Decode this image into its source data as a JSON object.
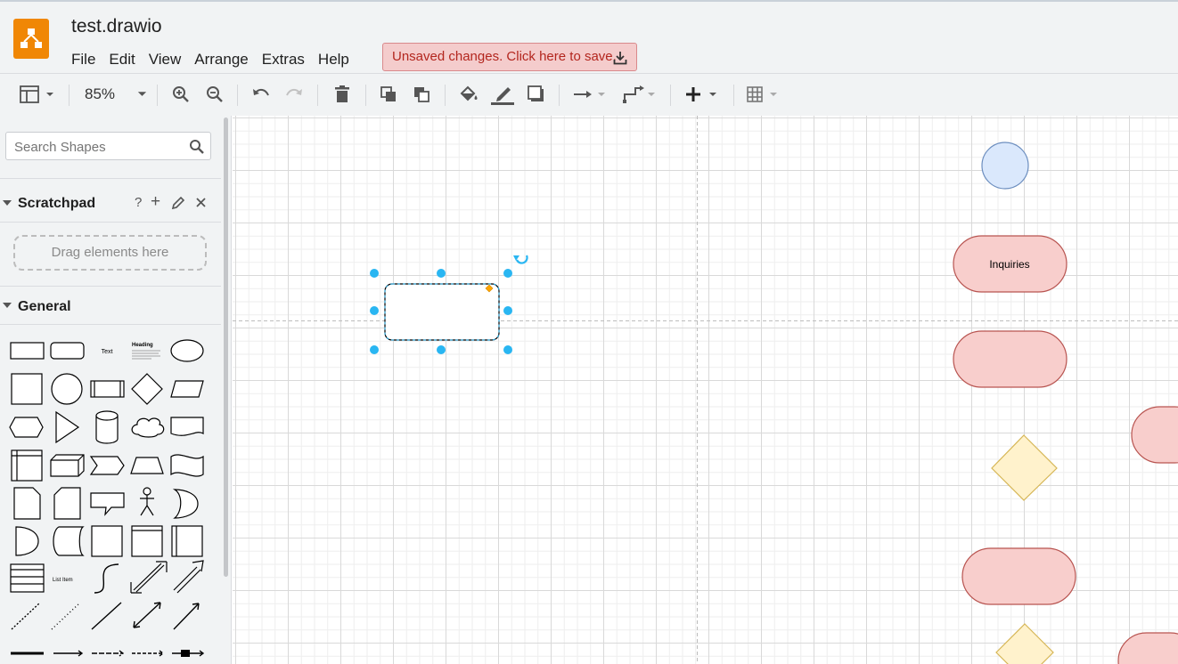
{
  "app": {
    "title": "test.drawio"
  },
  "menubar": {
    "items": [
      "File",
      "Edit",
      "View",
      "Arrange",
      "Extras",
      "Help"
    ]
  },
  "save_banner": {
    "text": "Unsaved changes. Click here to save."
  },
  "toolbar": {
    "zoom": "85%"
  },
  "sidebar": {
    "search_placeholder": "Search Shapes",
    "scratchpad": {
      "title": "Scratchpad",
      "help": "?",
      "add": "+",
      "drop_hint": "Drag elements here"
    },
    "general": {
      "title": "General",
      "shapes": [
        "rectangle",
        "rounded-rectangle",
        "text",
        "heading",
        "ellipse",
        "square",
        "circle",
        "process",
        "diamond",
        "parallelogram",
        "hexagon",
        "triangle",
        "cylinder",
        "cloud",
        "document",
        "internal-storage",
        "cube",
        "step",
        "trapezoid",
        "tape",
        "note",
        "card",
        "callout",
        "actor",
        "or",
        "and",
        "data-storage",
        "square-2",
        "container",
        "list",
        "list-2",
        "list-item",
        "curve",
        "bidirectional-arrow",
        "arrow",
        "dashed-line",
        "dotted-line",
        "line",
        "bidirectional-connector",
        "directional-connector",
        "link",
        "connector-label",
        "connector-label-2",
        "connector-label-3",
        "connector-icon"
      ],
      "labels": {
        "text": "Text",
        "heading": "Heading",
        "list_item": "List Item"
      }
    }
  },
  "canvas": {
    "nodes": [
      {
        "label": "Inquiries"
      }
    ],
    "colors": {
      "blue_fill": "#dae8fc",
      "blue_stroke": "#6c8ebf",
      "red_fill": "#f8cecc",
      "red_stroke": "#b85450",
      "yellow_fill": "#fff2cc",
      "yellow_stroke": "#d6b656",
      "handle": "#29b6f2",
      "accent": "#f08705"
    }
  }
}
